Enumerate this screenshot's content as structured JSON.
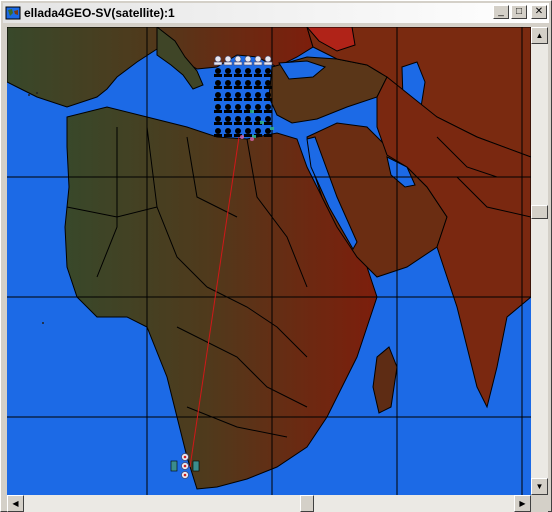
{
  "window": {
    "title": "ellada4GEO-SV(satellite):1",
    "controls": {
      "minimize": "_",
      "maximize": "□",
      "close": "✕"
    }
  },
  "map": {
    "icon_names": [
      "satellite-icon",
      "ground-station-icon"
    ],
    "colors": {
      "ocean": "#1c6ae6",
      "land_west": "#3b4a25",
      "land_east": "#7a2a10",
      "borders": "#000000",
      "link_line": "#d01818"
    }
  },
  "scrollbars": {
    "vertical": {
      "up": "▲",
      "down": "▼"
    },
    "horizontal": {
      "left": "◀",
      "right": "▶"
    }
  }
}
